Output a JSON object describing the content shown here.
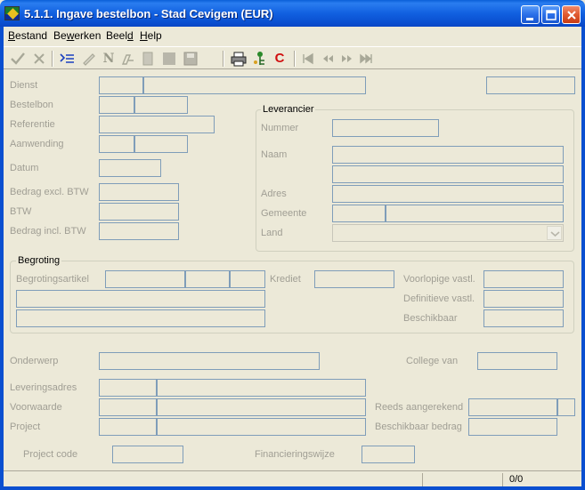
{
  "window": {
    "title": "5.1.1. Ingave bestelbon - Stad Cevigem (EUR)"
  },
  "menu": {
    "items": [
      {
        "pre": "",
        "key": "B",
        "post": "estand"
      },
      {
        "pre": "Be",
        "key": "w",
        "post": "erken"
      },
      {
        "pre": "Beel",
        "key": "d",
        "post": ""
      },
      {
        "pre": "",
        "key": "H",
        "post": "elp"
      }
    ]
  },
  "toolbar": {
    "icons": [
      "check-icon",
      "cross-icon",
      "list-arrow-icon",
      "edit-icon",
      "new-icon",
      "copy-icon",
      "blank-icon",
      "save-icon",
      "print-icon",
      "tree-icon",
      "c-icon",
      "first-icon",
      "prev-icon",
      "next-icon",
      "last-icon"
    ],
    "c_label": "C",
    "n_label": "N"
  },
  "form": {
    "dienst": "Dienst",
    "bestelbon": "Bestelbon",
    "referentie": "Referentie",
    "aanwending": "Aanwending",
    "datum": "Datum",
    "bedrag_excl": "Bedrag excl. BTW",
    "btw": "BTW",
    "bedrag_incl": "Bedrag incl. BTW",
    "leverancier": {
      "title": "Leverancier",
      "nummer": "Nummer",
      "naam": "Naam",
      "adres": "Adres",
      "gemeente": "Gemeente",
      "land": "Land"
    },
    "begroting": {
      "title": "Begroting",
      "begrotingsartikel": "Begrotingsartikel",
      "krediet": "Krediet",
      "voorlopige": "Voorlopige vastl.",
      "definitieve": "Definitieve vastl.",
      "beschikbaar": "Beschikbaar"
    },
    "onderwerp": "Onderwerp",
    "college_van": "College van",
    "leveringsadres": "Leveringsadres",
    "voorwaarde": "Voorwaarde",
    "reeds_aangerekend": "Reeds aangerekend",
    "project": "Project",
    "beschikbaar_bedrag": "Beschikbaar bedrag",
    "project_code": "Project code",
    "financieringswijze": "Financieringswijze"
  },
  "status": {
    "record_count": "0/0"
  },
  "colors": {
    "titlebar": "#0a5fd8",
    "field_border": "#7f9db9",
    "disabled_label": "#a09e94",
    "background": "#ece9d8"
  }
}
